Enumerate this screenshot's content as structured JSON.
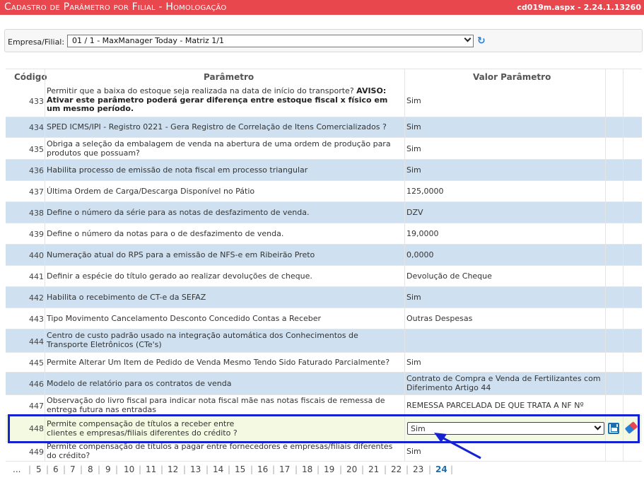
{
  "header": {
    "title": "Cadastro de Parâmetro por Filial  - Homologação",
    "version": "cd019m.aspx - 2.24.1.13260"
  },
  "filter": {
    "label": "Empresa/Filial:",
    "selected": "01 / 1 - MaxManager Today - Matriz 1/1"
  },
  "grid": {
    "columns": {
      "codigo": "Código",
      "parametro": "Parâmetro",
      "valor": "Valor Parâmetro"
    },
    "rows": [
      {
        "code": "433",
        "param_pre": "Permitir que a baixa do estoque seja realizada na data de início do transporte?",
        "param_bold": "AVISO: Ativar este parâmetro poderá gerar diferença entre estoque fiscal x físico em um mesmo período.",
        "value": "Sim"
      },
      {
        "code": "434",
        "param": "SPED ICMS/IPI - Registro 0221 - Gera Registro de Correlação de Itens Comercializados ?",
        "value": "Sim"
      },
      {
        "code": "435",
        "param": "Obriga a seleção da embalagem de venda na abertura de uma ordem de produção para produtos que possuam?",
        "value": "Sim"
      },
      {
        "code": "436",
        "param": "Habilita processo de emissão de nota fiscal em processo triangular",
        "value": "Sim"
      },
      {
        "code": "437",
        "param": "Última Ordem de Carga/Descarga Disponível no Pátio",
        "value": "125,0000"
      },
      {
        "code": "438",
        "param": "Define o número da série para as notas de desfazimento de venda.",
        "value": "DZV"
      },
      {
        "code": "439",
        "param": "Define o número da notas para o de desfazimento de venda.",
        "value": "19,0000"
      },
      {
        "code": "440",
        "param": "Numeração atual do RPS para a emissão de NFS-e em Ribeirão Preto",
        "value": "0,0000"
      },
      {
        "code": "441",
        "param": "Definir a espécie do título gerado ao realizar devoluções de cheque.",
        "value": "Devolução de Cheque"
      },
      {
        "code": "442",
        "param": "Habilita o recebimento de CT-e da SEFAZ",
        "value": "Sim"
      },
      {
        "code": "443",
        "param": "Tipo Movimento Cancelamento Desconto Concedido Contas a Receber",
        "value": "Outras Despesas"
      },
      {
        "code": "444",
        "param": "Centro de custo padrão usado na integração automática dos Conhecimentos de Transporte Eletrônicos (CTe's)",
        "value": ""
      },
      {
        "code": "445",
        "param": "Permite Alterar Um Item de Pedido de Venda Mesmo Tendo Sido Faturado Parcialmente?",
        "value": "Sim"
      },
      {
        "code": "446",
        "param": "Modelo de relatório para os contratos de venda",
        "value": "Contrato de Compra e Venda de Fertilizantes com Diferimento Artigo 44"
      },
      {
        "code": "447",
        "param": "Observação do livro fiscal para indicar nota fiscal mãe nas notas fiscais de remessa de entrega futura nas entradas",
        "value": "REMESSA PARCELADA DE QUE TRATA A NF Nº"
      },
      {
        "code": "448",
        "param_line1": "Permite compensação de títulos a receber entre",
        "param_line2": "clientes e empresas/filiais diferentes do crédito ?",
        "value": "Sim"
      },
      {
        "code": "449",
        "param": "Permite compensação de títulos a pagar entre fornecedores e empresas/filiais diferentes do crédito?",
        "value": "Sim"
      }
    ]
  },
  "pager": {
    "ellipsis": "...",
    "pages": [
      "5",
      "6",
      "7",
      "8",
      "9",
      "10",
      "11",
      "12",
      "13",
      "14",
      "15",
      "16",
      "17",
      "18",
      "19",
      "20",
      "21",
      "22",
      "23"
    ],
    "current": "24"
  },
  "colors": {
    "title_bar": "#e8474d",
    "row_alt": "#cfe1f1",
    "row_edit": "#f4f9e2",
    "highlight": "#1422d2"
  }
}
